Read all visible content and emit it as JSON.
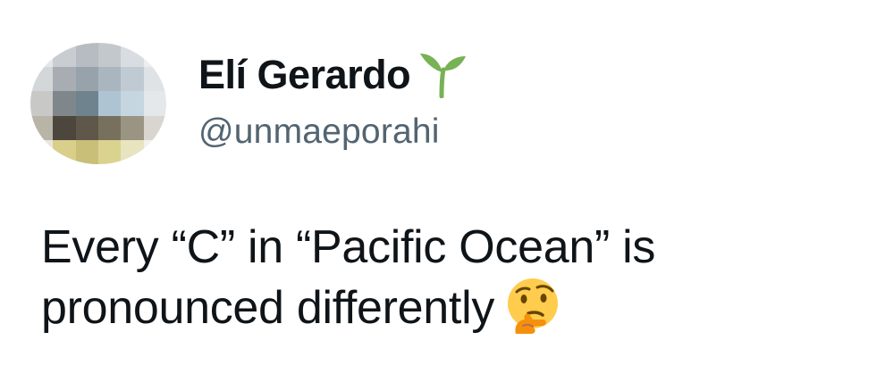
{
  "author": {
    "display_name": "Elí Gerardo",
    "handle": "@unmaeporahi",
    "badge_icon": "seedling-icon",
    "avatar_blurred": true
  },
  "tweet": {
    "line1": "Every “C” in “Pacific Ocean” is",
    "line2": "pronounced differently",
    "emoji_icon": "thinking-face-icon"
  },
  "colors": {
    "text_primary": "#0f1419",
    "text_secondary": "#536471",
    "sprout_green": "#77b255",
    "emoji_yellow": "#ffcc4d"
  }
}
